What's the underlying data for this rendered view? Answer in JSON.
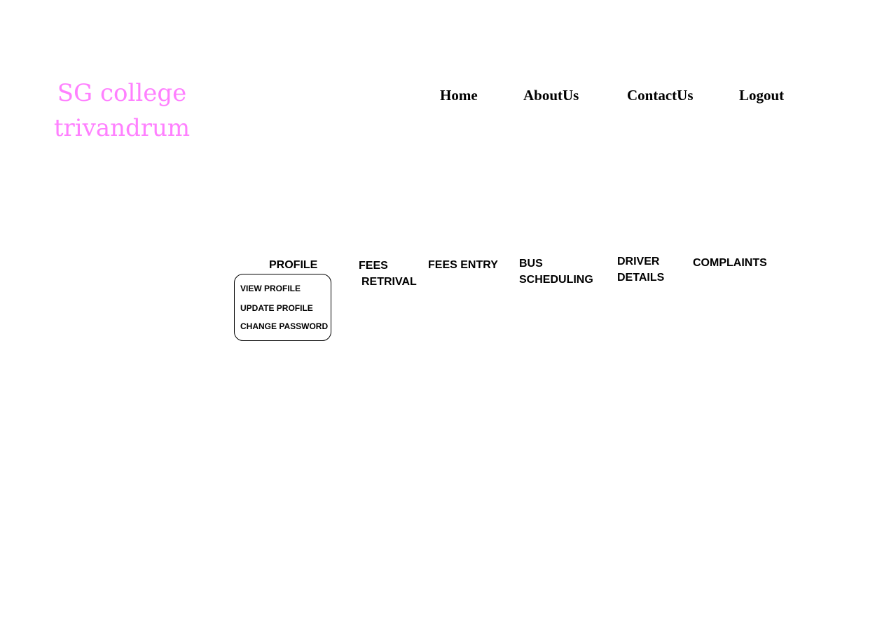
{
  "brand": {
    "line1": "SG college",
    "line2": "trivandrum",
    "color": "#ff80ff"
  },
  "top_nav": {
    "home": "Home",
    "about": "AboutUs",
    "contact": "ContactUs",
    "logout": "Logout"
  },
  "menu": {
    "profile": "PROFILE",
    "fees_retrival_line1": "FEES",
    "fees_retrival_line2": "RETRIVAL",
    "fees_entry": "FEES ENTRY",
    "bus_scheduling_line1": "BUS",
    "bus_scheduling_line2": "SCHEDULING",
    "driver_details_line1": "DRIVER",
    "driver_details_line2": "DETAILS",
    "complaints": "COMPLAINTS"
  },
  "profile_dropdown": {
    "view_profile": "VIEW PROFILE",
    "update_profile": "UPDATE PROFILE",
    "change_password": "CHANGE PASSWORD"
  }
}
